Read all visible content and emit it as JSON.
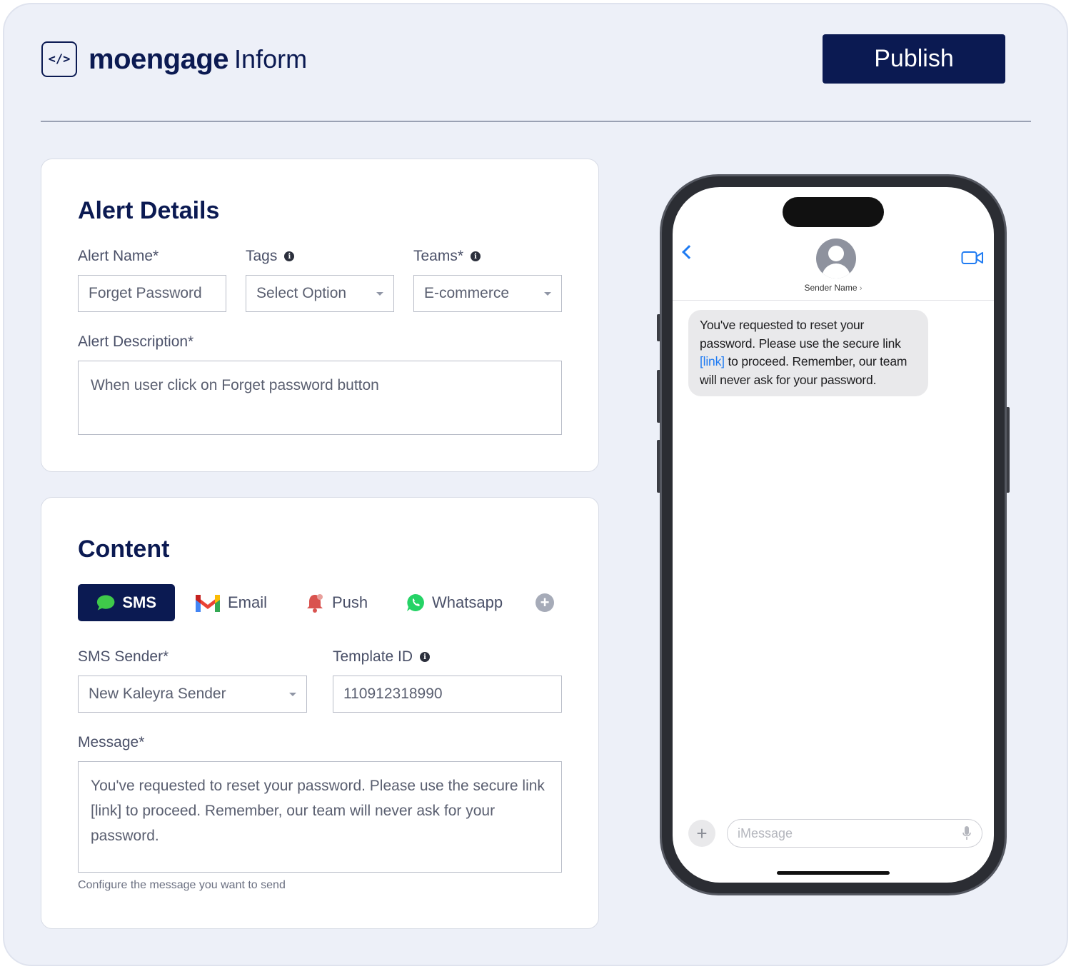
{
  "header": {
    "logo_glyph": "</>",
    "brand_name": "moengage",
    "brand_product": "Inform",
    "publish_label": "Publish"
  },
  "alert_details": {
    "title": "Alert Details",
    "alert_name_label": "Alert Name*",
    "alert_name_value": "Forget Password",
    "tags_label": "Tags",
    "tags_value": "Select Option",
    "teams_label": "Teams*",
    "teams_value": "E-commerce",
    "description_label": "Alert Description*",
    "description_value": "When user click on Forget password button"
  },
  "content": {
    "title": "Content",
    "tabs": [
      {
        "label": "SMS",
        "icon": "sms-bubble-icon",
        "active": true
      },
      {
        "label": "Email",
        "icon": "gmail-icon",
        "active": false
      },
      {
        "label": "Push",
        "icon": "bell-icon",
        "active": false
      },
      {
        "label": "Whatsapp",
        "icon": "whatsapp-icon",
        "active": false
      }
    ],
    "sms_sender_label": "SMS Sender*",
    "sms_sender_value": "New Kaleyra Sender",
    "template_id_label": "Template ID",
    "template_id_value": "110912318990",
    "message_label": "Message*",
    "message_value": "You've requested to reset your password. Please use the secure link [link] to proceed. Remember, our team will never ask for your password.",
    "message_helper": "Configure the message you want to send"
  },
  "phone_preview": {
    "sender_name": "Sender Name",
    "bubble_part1": "You've requested to reset your password. Please use the secure link ",
    "bubble_link": "[link]",
    "bubble_part2": " to proceed. Remember, our team will never ask for your password.",
    "input_placeholder": "iMessage"
  },
  "colors": {
    "brand_navy": "#0b1a52",
    "background": "#edf0f8",
    "ios_blue": "#1f7bf2",
    "bubble_gray": "#e9e9eb"
  }
}
